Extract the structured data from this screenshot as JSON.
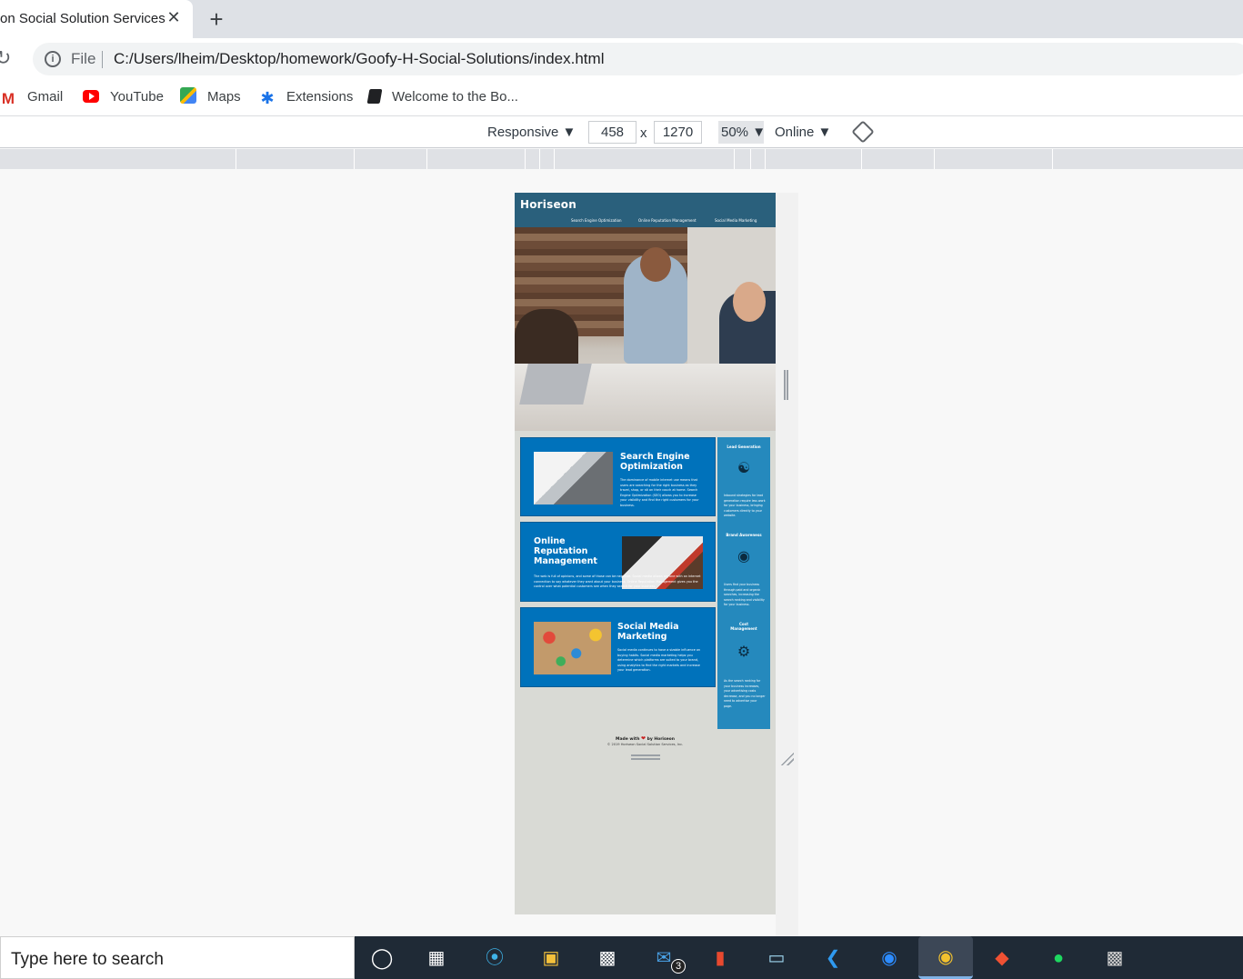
{
  "browser": {
    "tab": {
      "title": "on Social Solution Services",
      "close_glyph": "✕"
    },
    "new_tab_glyph": "+",
    "address": {
      "scheme": "File",
      "url": "C:/Users/lheim/Desktop/homework/Goofy-H-Social-Solutions/index.html"
    },
    "bookmarks": [
      {
        "label": "Gmail",
        "icon": "gmail-icon"
      },
      {
        "label": "YouTube",
        "icon": "youtube-icon"
      },
      {
        "label": "Maps",
        "icon": "maps-icon"
      },
      {
        "label": "Extensions",
        "icon": "extensions-icon"
      },
      {
        "label": "Welcome to the Bo...",
        "icon": "book-icon"
      }
    ]
  },
  "device_toolbar": {
    "mode": "Responsive ▼",
    "width": "458",
    "times": "x",
    "height": "1270",
    "zoom": "50% ▼",
    "network": "Online ▼"
  },
  "site": {
    "logo": "Horiseon",
    "nav": [
      "Search Engine Optimization",
      "Online Reputation Management",
      "Social Media Marketing"
    ],
    "cards": [
      {
        "title": "Search Engine Optimization",
        "text": "The dominance of mobile internet use means that users are searching for the right business as they travel, shop, or sit on their couch at home. Search Engine Optimization (SEO) allows you to increase your visibility and find the right customers for your business."
      },
      {
        "title": "Online Reputation Management",
        "text": "The web is full of opinions, and some of those can be negative. Social media allows anyone with an internet connection to say whatever they want about your business. Online Reputation Management gives you the control over what potential customers see when they search for your business."
      },
      {
        "title": "Social Media Marketing",
        "text": "Social media continues to have a sizable influence on buying habits. Social media marketing helps you determine which platforms are suited to your brand, using analytics to find the right markets and increase your lead generation."
      }
    ],
    "benefits": [
      {
        "title": "Lead Generation",
        "icon": "lead-generation-icon",
        "text": "Inbound strategies for lead generation require less work for your business, bringing customers directly to your website."
      },
      {
        "title": "Brand Awareness",
        "icon": "brand-awareness-icon",
        "text": "Users find your business through paid and organic searches, increasing the search ranking and visibility for your business."
      },
      {
        "title": "Cost Management",
        "icon": "cost-management-icon",
        "text": "As the search ranking for your business increases, your advertising costs decrease, and you no longer need to advertise your page."
      }
    ],
    "footer": {
      "made_with": "Made with",
      "by": "by Horiseon",
      "copyright": "© 2019 Horiseon Social Solution Services, Inc."
    }
  },
  "taskbar": {
    "search_placeholder": "Type here to search",
    "mail_badge": "3",
    "apps": [
      "cortana-icon",
      "task-view-icon",
      "edge-icon",
      "file-explorer-icon",
      "store-icon",
      "mail-icon",
      "office-icon",
      "notepad-icon",
      "vscode-icon",
      "zoom-icon",
      "chrome-icon",
      "git-icon",
      "spotify-icon",
      "terminal-icon"
    ]
  },
  "colors": {
    "header": "#2a607c",
    "card": "#0072bb",
    "benefits": "#2589bd",
    "page_bg": "#d9dad5"
  }
}
